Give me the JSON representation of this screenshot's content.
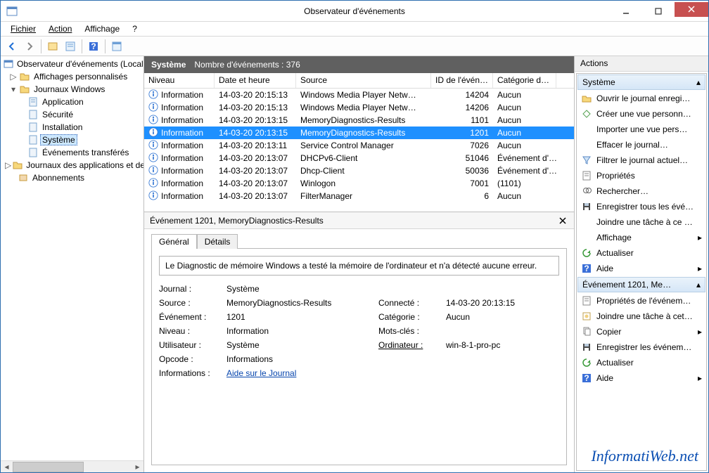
{
  "window": {
    "title": "Observateur d'événements"
  },
  "menus": [
    "Fichier",
    "Action",
    "Affichage",
    "?"
  ],
  "tree": {
    "root": "Observateur d'événements (Local)",
    "custom": "Affichages personnalisés",
    "winlogs": "Journaux Windows",
    "app": "Application",
    "sec": "Sécurité",
    "inst": "Installation",
    "sys": "Système",
    "fwd": "Événements transférés",
    "appsvc": "Journaux des applications et des services",
    "subs": "Abonnements"
  },
  "center": {
    "title": "Système",
    "count_label": "Nombre d'événements : 376",
    "columns": [
      "Niveau",
      "Date et heure",
      "Source",
      "ID de l'événe…",
      "Catégorie de l…"
    ],
    "rows": [
      {
        "level": "Information",
        "date": "14-03-20 20:15:13",
        "source": "Windows Media Player Netw…",
        "id": "14204",
        "cat": "Aucun",
        "sel": false
      },
      {
        "level": "Information",
        "date": "14-03-20 20:15:13",
        "source": "Windows Media Player Netw…",
        "id": "14206",
        "cat": "Aucun",
        "sel": false
      },
      {
        "level": "Information",
        "date": "14-03-20 20:13:15",
        "source": "MemoryDiagnostics-Results",
        "id": "1101",
        "cat": "Aucun",
        "sel": false
      },
      {
        "level": "Information",
        "date": "14-03-20 20:13:15",
        "source": "MemoryDiagnostics-Results",
        "id": "1201",
        "cat": "Aucun",
        "sel": true
      },
      {
        "level": "Information",
        "date": "14-03-20 20:13:11",
        "source": "Service Control Manager",
        "id": "7026",
        "cat": "Aucun",
        "sel": false
      },
      {
        "level": "Information",
        "date": "14-03-20 20:13:07",
        "source": "DHCPv6-Client",
        "id": "51046",
        "cat": "Événement d'…",
        "sel": false
      },
      {
        "level": "Information",
        "date": "14-03-20 20:13:07",
        "source": "Dhcp-Client",
        "id": "50036",
        "cat": "Événement d'…",
        "sel": false
      },
      {
        "level": "Information",
        "date": "14-03-20 20:13:07",
        "source": "Winlogon",
        "id": "7001",
        "cat": "(1101)",
        "sel": false
      },
      {
        "level": "Information",
        "date": "14-03-20 20:13:07",
        "source": "FilterManager",
        "id": "6",
        "cat": "Aucun",
        "sel": false
      }
    ]
  },
  "detail": {
    "title": "Événement 1201, MemoryDiagnostics-Results",
    "tabs": [
      "Général",
      "Détails"
    ],
    "message": "Le Diagnostic de mémoire Windows a testé la mémoire de l'ordinateur et n'a détecté aucune erreur.",
    "fields": {
      "journal_l": "Journal :",
      "journal_v": "Système",
      "source_l": "Source :",
      "source_v": "MemoryDiagnostics-Results",
      "connecte_l": "Connecté :",
      "connecte_v": "14-03-20 20:13:15",
      "event_l": "Événement :",
      "event_v": "1201",
      "cat_l": "Catégorie :",
      "cat_v": "Aucun",
      "niveau_l": "Niveau :",
      "niveau_v": "Information",
      "mots_l": "Mots-clés :",
      "mots_v": "",
      "user_l": "Utilisateur :",
      "user_v": "Système",
      "ord_l": "Ordinateur :",
      "ord_v": "win-8-1-pro-pc",
      "opcode_l": "Opcode :",
      "opcode_v": "Informations",
      "info_l": "Informations :",
      "info_link": "Aide sur le Journal"
    }
  },
  "actions": {
    "header": "Actions",
    "sec1": "Système",
    "sec1_items": [
      "Ouvrir le journal enregi…",
      "Créer une vue personn…",
      "Importer une vue pers…",
      "Effacer le journal…",
      "Filtrer le journal actuel…",
      "Propriétés",
      "Rechercher…",
      "Enregistrer tous les évé…",
      "Joindre une tâche à ce …",
      "Affichage",
      "Actualiser",
      "Aide"
    ],
    "sec2": "Événement 1201, Me…",
    "sec2_items": [
      "Propriétés de l'événem…",
      "Joindre une tâche à cet…",
      "Copier",
      "Enregistrer les événem…",
      "Actualiser",
      "Aide"
    ]
  },
  "watermark": "InformatiWeb.net"
}
